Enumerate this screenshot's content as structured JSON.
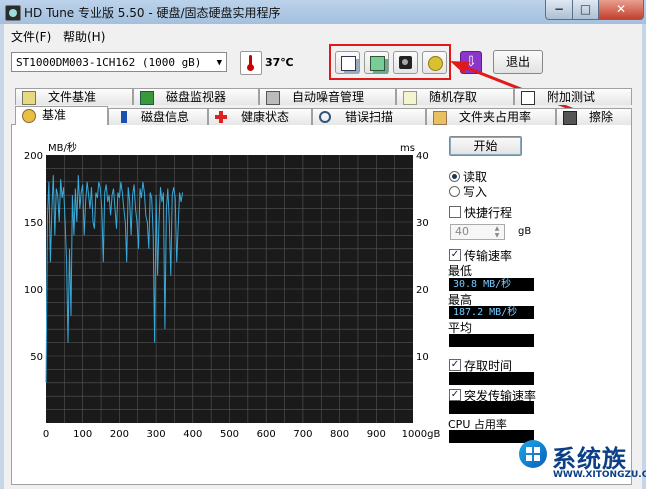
{
  "window": {
    "title": "HD Tune 专业版 5.50 - 硬盘/固态硬盘实用程序",
    "min": "−",
    "max": "□",
    "close": "✕"
  },
  "menu": {
    "file": "文件(F)",
    "help": "帮助(H)"
  },
  "toolbar": {
    "drive": "ST1000DM003-1CH162 (1000 gB)",
    "temperature": "37℃",
    "exit_label": "退出",
    "icons": [
      "copy-text-icon",
      "copy-clipboard-icon",
      "camera-icon",
      "options-icon",
      "save-down-icon"
    ]
  },
  "tabs": {
    "back_row": [
      "文件基准",
      "磁盘监视器",
      "自动噪音管理",
      "随机存取",
      "附加测试"
    ],
    "front_row": [
      "基准",
      "磁盘信息",
      "健康状态",
      "错误扫描",
      "文件夹占用率",
      "擦除"
    ],
    "active": "基准"
  },
  "right_panel": {
    "start_label": "开始",
    "read_label": "读取",
    "write_label": "写入",
    "quick_stroke_label": "快捷行程",
    "quick_stroke_value": "40",
    "quick_stroke_unit": "gB",
    "transfer_rate_label": "传输速率",
    "min_label": "最低",
    "min_value": "30.8 MB/秒",
    "max_label": "最高",
    "max_value": "187.2 MB/秒",
    "avg_label": "平均",
    "avg_value": "",
    "access_time_label": "存取时间",
    "access_time_value": "",
    "burst_rate_label": "突发传输速率",
    "burst_rate_value": "",
    "cpu_label": "CPU 占用率",
    "cpu_value": ""
  },
  "watermark": {
    "text": "系统族",
    "url": "WWW.XITONGZU.COM"
  },
  "chart_data": {
    "type": "line",
    "ylabel_left": "MB/秒",
    "ylabel_right": "ms",
    "xlabel": "",
    "ylim": [
      0,
      200
    ],
    "y_right_lim": [
      0,
      40
    ],
    "xlim": [
      0,
      1000
    ],
    "y_ticks": [
      50,
      100,
      150,
      200
    ],
    "y_right_ticks": [
      10,
      20,
      30,
      40
    ],
    "x_ticks": [
      "0",
      "100",
      "200",
      "300",
      "400",
      "500",
      "600",
      "700",
      "800",
      "900",
      "1000gB"
    ],
    "grid": true,
    "series": [
      {
        "color": "#3aa8d8",
        "x": [
          0,
          4,
          8,
          12,
          16,
          20,
          24,
          28,
          32,
          36,
          40,
          44,
          48,
          52,
          56,
          60,
          64,
          68,
          72,
          76,
          80,
          84,
          88,
          92,
          96,
          100,
          104,
          108,
          112,
          116,
          120,
          124,
          128,
          132,
          136,
          140,
          144,
          148,
          152,
          156,
          160,
          164,
          168,
          172,
          176,
          180,
          184,
          188,
          192,
          196,
          200,
          204,
          208,
          212,
          216,
          220,
          224,
          228,
          232,
          236,
          240,
          244,
          248,
          252,
          256,
          260,
          264,
          268,
          272,
          276,
          280,
          284,
          288,
          292,
          296,
          300,
          304,
          308,
          312,
          316,
          320,
          324,
          328,
          332,
          336,
          340,
          344,
          348,
          352,
          356,
          360,
          364,
          368,
          372
        ],
        "y": [
          30,
          155,
          180,
          120,
          160,
          185,
          140,
          175,
          170,
          150,
          182,
          168,
          176,
          150,
          120,
          60,
          130,
          80,
          170,
          140,
          175,
          150,
          185,
          160,
          172,
          178,
          140,
          165,
          180,
          170,
          160,
          176,
          150,
          145,
          172,
          168,
          180,
          175,
          160,
          120,
          172,
          178,
          165,
          170,
          155,
          170,
          175,
          160,
          145,
          172,
          168,
          180,
          172,
          160,
          150,
          120,
          176,
          165,
          140,
          170,
          178,
          160,
          150,
          130,
          175,
          168,
          180,
          172,
          155,
          150,
          130,
          172,
          168,
          140,
          60,
          170,
          110,
          150,
          176,
          165,
          172,
          70,
          160,
          175,
          150,
          110,
          170,
          176,
          168,
          120,
          145,
          172,
          165,
          172
        ]
      }
    ]
  }
}
